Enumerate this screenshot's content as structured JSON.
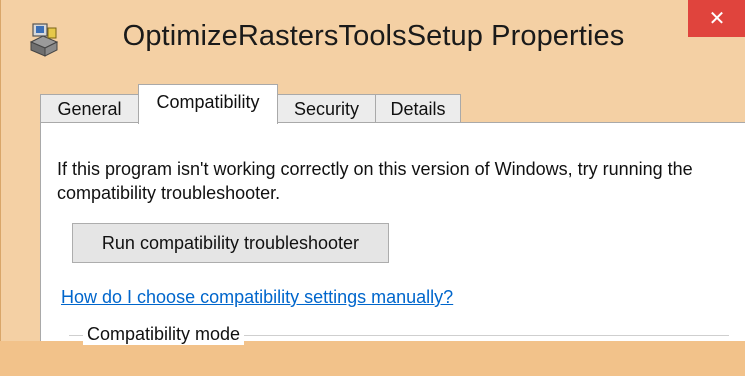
{
  "window": {
    "title": "OptimizeRastersToolsSetup Properties",
    "icon": "setup-program-icon",
    "close_symbol": "✕",
    "accent_close": "#e0443d"
  },
  "tabs": [
    {
      "label": "General",
      "active": false
    },
    {
      "label": "Compatibility",
      "active": true
    },
    {
      "label": "Security",
      "active": false
    },
    {
      "label": "Details",
      "active": false
    }
  ],
  "compatibility": {
    "description": "If this program isn't working correctly on this version of Windows, try running the compatibility troubleshooter.",
    "run_button_label": "Run compatibility troubleshooter",
    "help_link": "How do I choose compatibility settings manually?",
    "group_label": "Compatibility mode"
  }
}
